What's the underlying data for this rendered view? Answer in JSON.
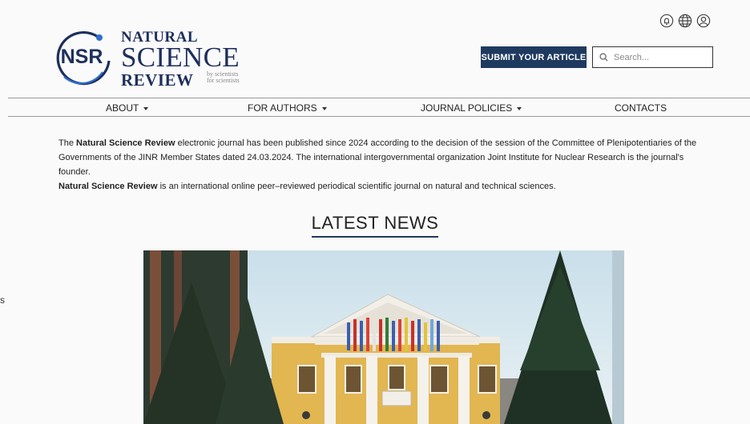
{
  "header": {
    "icons": [
      "bell-icon",
      "globe-icon",
      "user-icon"
    ],
    "logo": {
      "mark": "NSR",
      "line1": "NATURAL",
      "line2": "SCIENCE",
      "line3": "REVIEW",
      "tagline_1": "by scientists",
      "tagline_2": "for scientists"
    },
    "submit_label": "SUBMIT YOUR ARTICLE",
    "search_placeholder": "Search..."
  },
  "nav": {
    "items": [
      {
        "label": "ABOUT",
        "dropdown": true
      },
      {
        "label": "FOR AUTHORS",
        "dropdown": true
      },
      {
        "label": "JOURNAL POLICIES",
        "dropdown": true
      },
      {
        "label": "CONTACTS",
        "dropdown": false
      }
    ]
  },
  "intro": {
    "p1_pre": "The ",
    "p1_bold": "Natural Science Review",
    "p1_post": " electronic journal  has been published since 2024 according to the decision of the session of the Committee of Plenipotentiaries of the Governments of the JINR Member States dated 24.03.2024. The international intergovernmental organization Joint Institute for Nuclear Research is the journal's founder.",
    "p2_bold": "Natural Science Review",
    "p2_post": " is an international online peer–reviewed periodical scientific journal on natural and technical sciences."
  },
  "news": {
    "title": "LATEST NEWS"
  },
  "edge_glyph": "s",
  "colors": {
    "brand_navy": "#1f3a5f",
    "logo_text": "#1e2f5c",
    "logo_accent": "#2f6fd0"
  }
}
